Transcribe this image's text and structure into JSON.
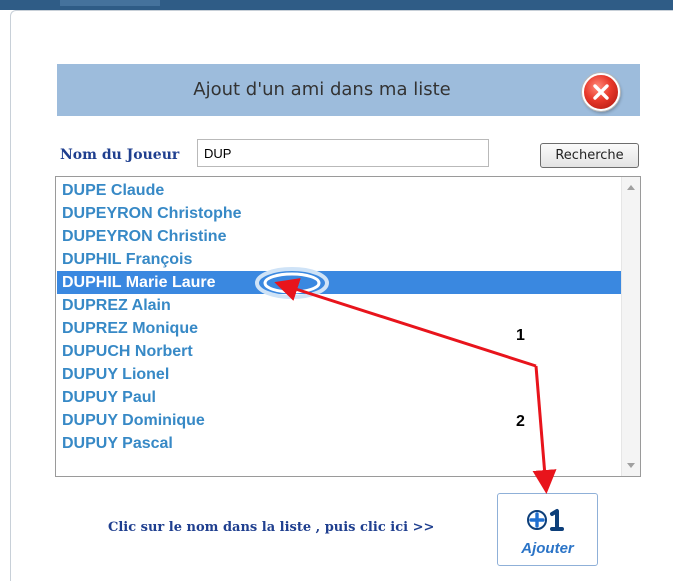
{
  "dialog": {
    "title": "Ajout d'un ami dans ma liste"
  },
  "search": {
    "label": "Nom du Joueur",
    "value": "DUP",
    "button_label": "Recherche"
  },
  "results": [
    "DUPE Claude",
    "DUPEYRON Christophe",
    "DUPEYRON Christine",
    "DUPHIL François",
    "DUPHIL Marie Laure",
    "DUPREZ Alain",
    "DUPREZ Monique",
    "DUPUCH Norbert",
    "DUPUY Lionel",
    "DUPUY Paul",
    "DUPUY Dominique",
    "DUPUY Pascal"
  ],
  "selected_result": "DUPHIL Marie Laure",
  "instruction": "Clic sur le nom dans la  liste , puis clic ici >>",
  "add_button": {
    "label": "Ajouter",
    "icon_text": "+1",
    "icon": "plus-one-icon"
  },
  "annotations": {
    "step1": "1",
    "step2": "2"
  },
  "colors": {
    "title_bar": "#9dbcdc",
    "link_blue": "#3789c6",
    "selected_bg": "#3a88e0",
    "label_navy": "#1f3f8f",
    "arrow_red": "#e8141c",
    "close_red": "#e8382a"
  }
}
